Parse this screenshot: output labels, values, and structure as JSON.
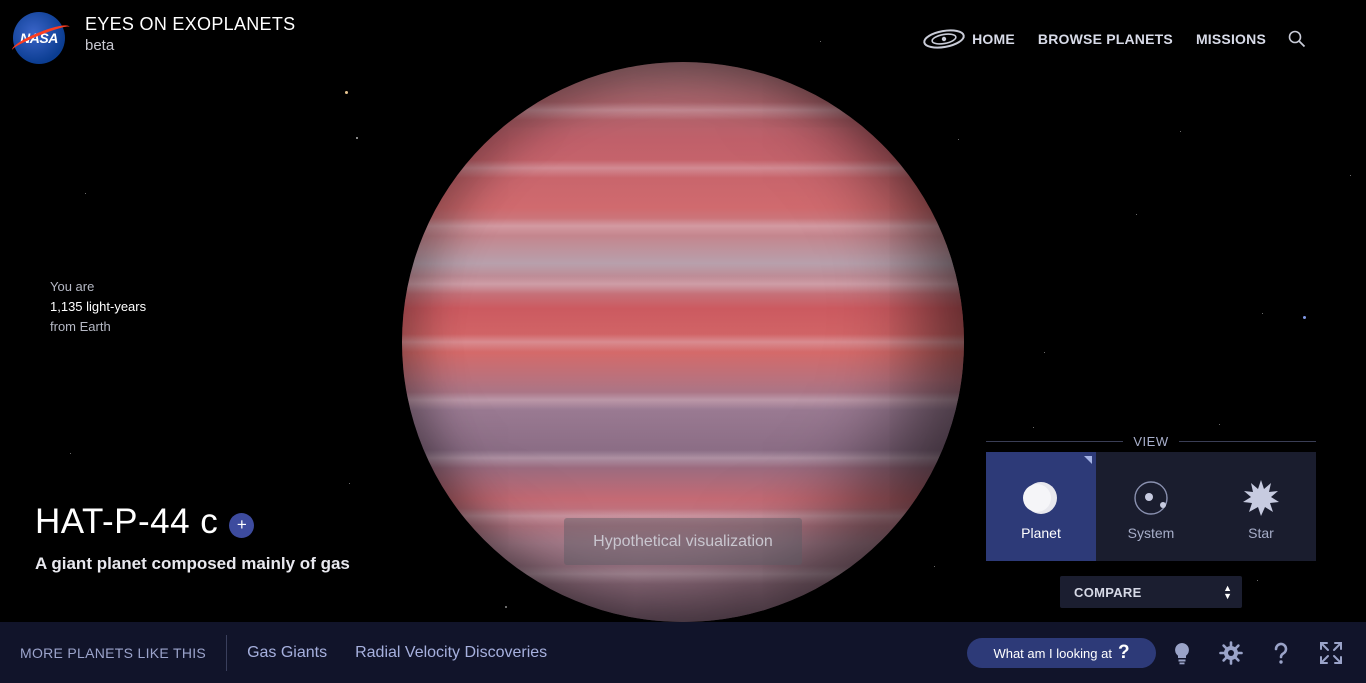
{
  "header": {
    "logo_text": "NASA",
    "title": "EYES ON EXOPLANETS",
    "subtitle": "beta"
  },
  "nav": {
    "home": "HOME",
    "browse": "BROWSE PLANETS",
    "missions": "MISSIONS"
  },
  "distance": {
    "line1": "You are",
    "line2": "1,135 light-years",
    "line3": "from Earth"
  },
  "planet": {
    "name": "HAT-P-44 c",
    "plus": "+",
    "description": "A giant planet composed mainly of gas"
  },
  "hypothetical_label": "Hypothetical visualization",
  "view": {
    "label": "VIEW",
    "options": [
      {
        "label": "Planet",
        "icon": "planet-icon",
        "active": true
      },
      {
        "label": "System",
        "icon": "system-icon",
        "active": false
      },
      {
        "label": "Star",
        "icon": "star-icon",
        "active": false
      }
    ]
  },
  "compare": {
    "label": "COMPARE"
  },
  "bottom": {
    "more_label": "MORE PLANETS LIKE THIS",
    "tags": [
      "Gas Giants",
      "Radial Velocity Discoveries"
    ],
    "looking_label": "What am I looking at",
    "looking_q": "?"
  },
  "colors": {
    "accent": "#2d3a78",
    "bar": "#11142a",
    "nasa_red": "#fc3d21",
    "nasa_blue": "#0b3d91"
  }
}
